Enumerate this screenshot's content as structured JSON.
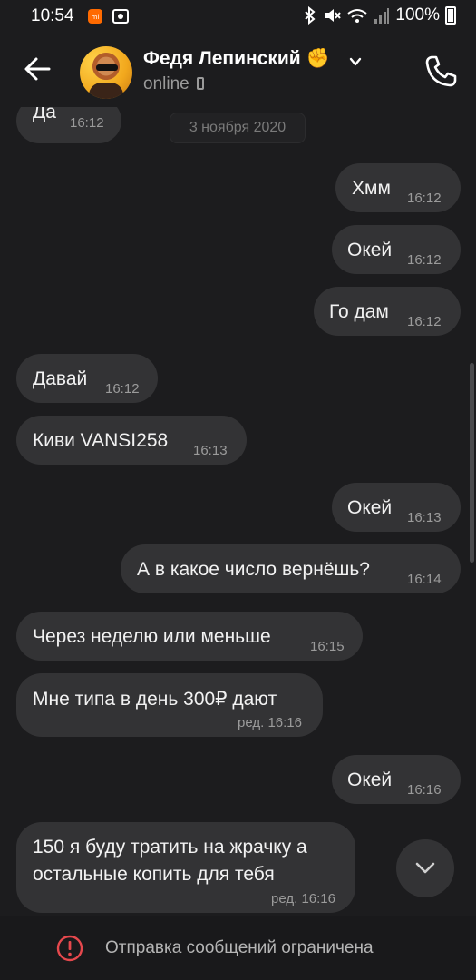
{
  "status_bar": {
    "time": "10:54",
    "battery": "100%"
  },
  "header": {
    "name": "Федя Лепинский ✊",
    "status": "online"
  },
  "date_separator": "3 ноября 2020",
  "messages": [
    {
      "side": "in",
      "text": "Да",
      "time": "16:12"
    },
    {
      "side": "out",
      "text": "Хмм",
      "time": "16:12"
    },
    {
      "side": "out",
      "text": "Окей",
      "time": "16:12"
    },
    {
      "side": "out",
      "text": "Го дам",
      "time": "16:12"
    },
    {
      "side": "in",
      "text": "Давай",
      "time": "16:12"
    },
    {
      "side": "in",
      "text": "Киви VANSI258",
      "time": "16:13"
    },
    {
      "side": "out",
      "text": "Окей",
      "time": "16:13"
    },
    {
      "side": "out",
      "text": "А в какое число вернёшь?",
      "time": "16:14"
    },
    {
      "side": "in",
      "text": "Через неделю или меньше",
      "time": "16:15"
    },
    {
      "side": "in",
      "text": "Мне типа в день 300₽ дают",
      "time": "ред. 16:16"
    },
    {
      "side": "out",
      "text": "Окей",
      "time": "16:16"
    },
    {
      "side": "in",
      "text_line1": "150 я буду тратить на жрачку а",
      "text_line2": "остальные копить для тебя",
      "time": "ред. 16:16"
    }
  ],
  "footer": {
    "notice": "Отправка сообщений ограничена"
  },
  "colors": {
    "background": "#1c1c1e",
    "bubble": "#333335",
    "warning": "#e5484d"
  }
}
